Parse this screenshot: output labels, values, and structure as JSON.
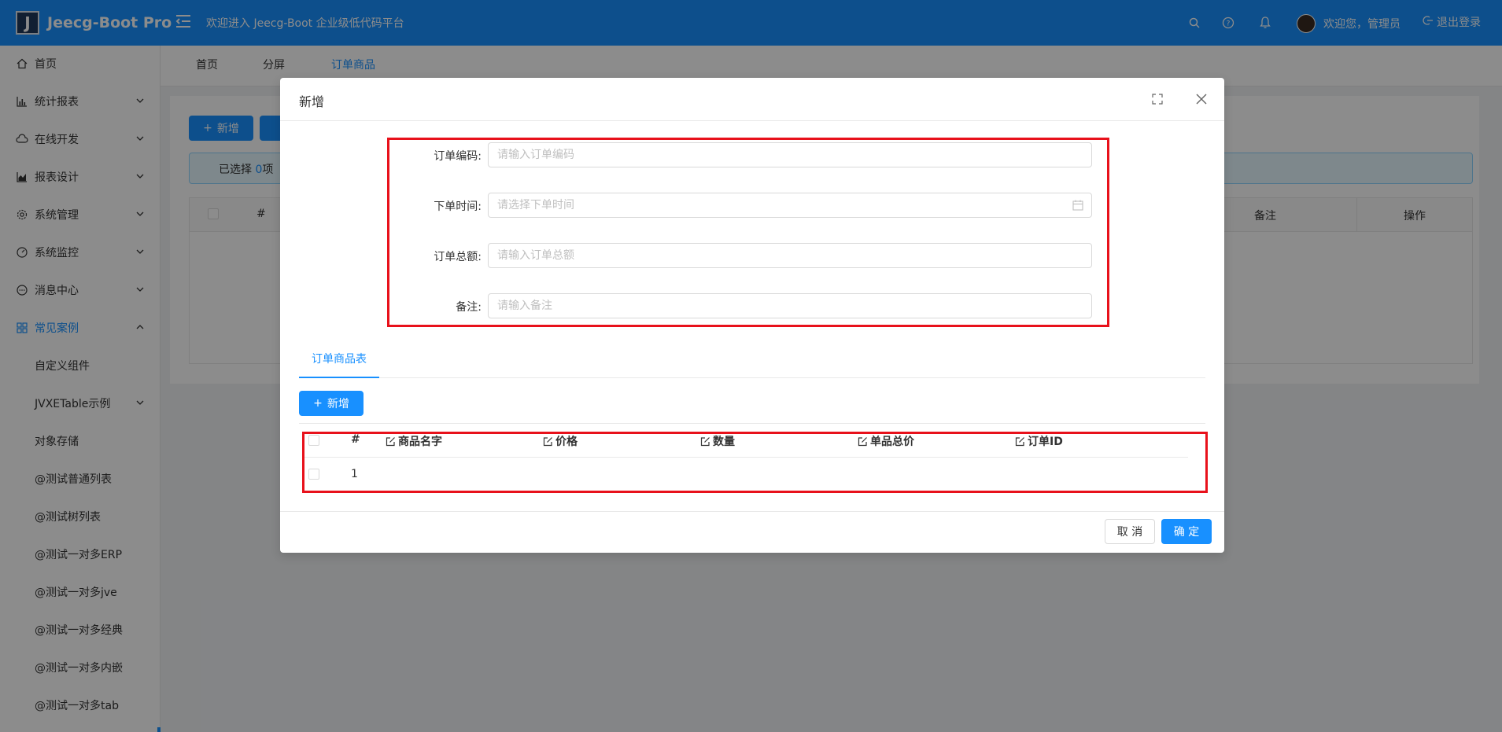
{
  "app": {
    "logo_letter": "J",
    "title": "Jeecg-Boot Pro",
    "welcome": "欢迎进入 Jeecg-Boot 企业级低代码平台",
    "user_greeting": "欢迎您，管理员",
    "logout": "退出登录"
  },
  "sidebar": {
    "items": [
      {
        "label": "首页",
        "icon": "home-icon"
      },
      {
        "label": "统计报表",
        "icon": "bar-chart-icon"
      },
      {
        "label": "在线开发",
        "icon": "cloud-icon"
      },
      {
        "label": "报表设计",
        "icon": "area-chart-icon"
      },
      {
        "label": "系统管理",
        "icon": "gear-icon"
      },
      {
        "label": "系统监控",
        "icon": "dashboard-icon"
      },
      {
        "label": "消息中心",
        "icon": "message-icon"
      },
      {
        "label": "常见案例",
        "icon": "appstore-icon"
      }
    ],
    "sub_items": [
      "自定义组件",
      "JVXETable示例",
      "对象存储",
      "@测试普通列表",
      "@测试树列表",
      "@测试一对多ERP",
      "@测试一对多jve",
      "@测试一对多经典",
      "@测试一对多内嵌",
      "@测试一对多tab"
    ]
  },
  "page_tabs": [
    "首页",
    "分屏",
    "订单商品"
  ],
  "background": {
    "new_button": "新增",
    "alert_prefix": "已选择 ",
    "alert_count": "0",
    "alert_suffix": "项",
    "columns": {
      "index": "#",
      "remark": "备注",
      "action": "操作"
    }
  },
  "modal": {
    "title": "新增",
    "form": [
      {
        "label": "订单编码:",
        "placeholder": "请输入订单编码"
      },
      {
        "label": "下单时间:",
        "placeholder": "请选择下单时间"
      },
      {
        "label": "订单总额:",
        "placeholder": "请输入订单总额"
      },
      {
        "label": "备注:",
        "placeholder": "请输入备注"
      }
    ],
    "sub_tab": "订单商品表",
    "sub_new_button": "新增",
    "sub_columns": [
      "#",
      "商品名字",
      "价格",
      "数量",
      "单品总价",
      "订单ID"
    ],
    "sub_rows": [
      {
        "index": "1"
      }
    ],
    "cancel": "取 消",
    "ok": "确 定"
  },
  "colors": {
    "primary": "#1890ff",
    "highlight": "#e8111b"
  }
}
